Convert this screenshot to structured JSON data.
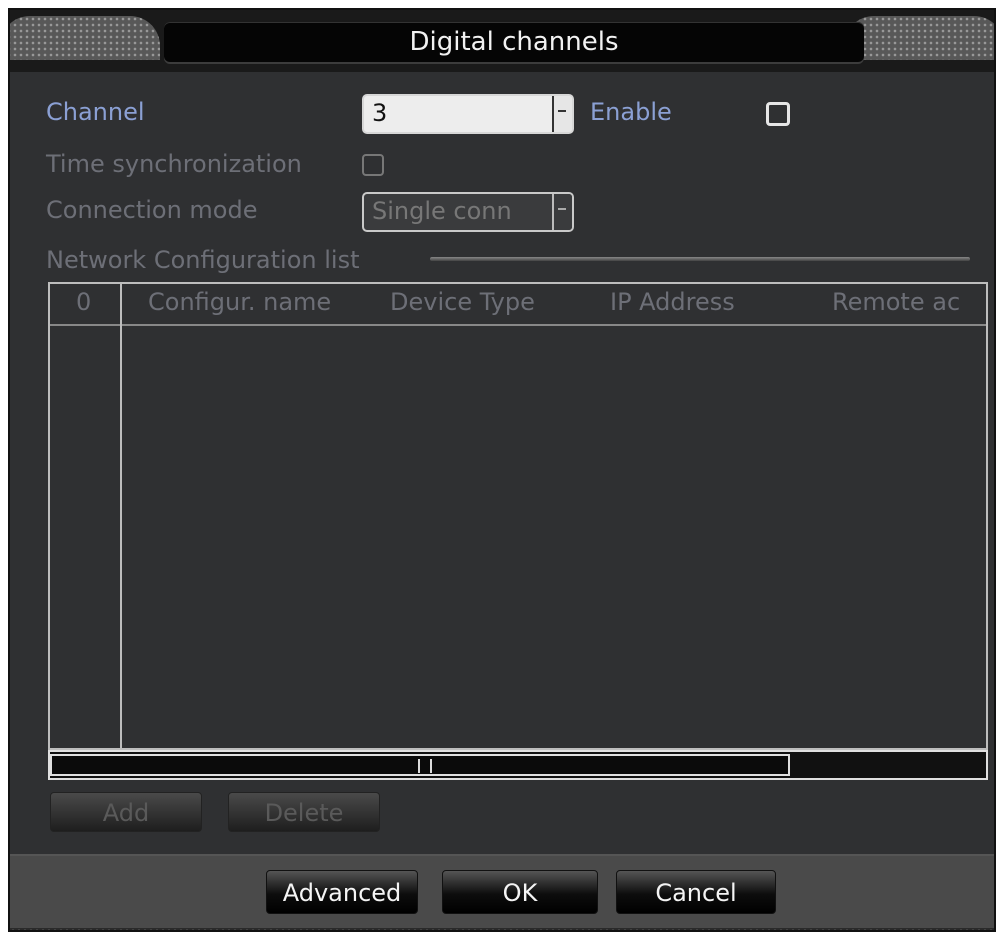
{
  "dialog": {
    "title": "Digital channels"
  },
  "form": {
    "channel_label": "Channel",
    "channel_value": "3",
    "enable_label": "Enable",
    "enable_checked": false,
    "time_sync_label": "Time synchronization",
    "time_sync_checked": false,
    "connection_mode_label": "Connection mode",
    "connection_mode_value": "Single conn"
  },
  "network_list": {
    "section_label": "Network Configuration list",
    "columns": [
      "0",
      "Configur. name",
      "Device Type",
      "IP Address",
      "Remote ac"
    ],
    "rows": []
  },
  "list_actions": {
    "add_label": "Add",
    "delete_label": "Delete"
  },
  "footer": {
    "advanced_label": "Advanced",
    "ok_label": "OK",
    "cancel_label": "Cancel"
  },
  "colors": {
    "panel_bg": "#2f3032",
    "active_label": "#8ba0d4",
    "disabled_label": "#6d6f77"
  }
}
